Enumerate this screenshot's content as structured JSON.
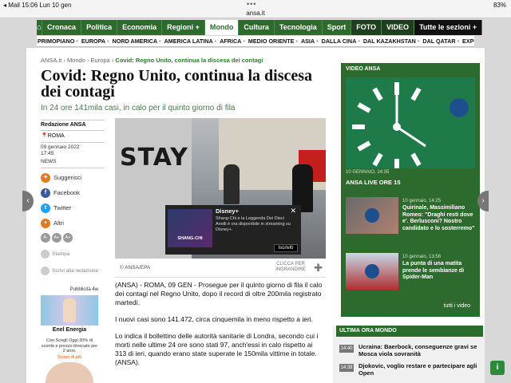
{
  "status": {
    "left": "◂ Mail   15:06   Lun 10 gen",
    "right": "83%"
  },
  "url": "ansa.it",
  "nav": {
    "items": [
      "Cronaca",
      "Politica",
      "Economia",
      "Regioni +",
      "Mondo",
      "Cultura",
      "Tecnologia",
      "Sport",
      "FOTO",
      "VIDEO",
      "Tutte le sezioni +"
    ]
  },
  "subnav": {
    "items": [
      "PRIMOPIANO",
      "EUROPA",
      "NORD AMERICA",
      "AMERICA LATINA",
      "AFRICA",
      "MEDIO ORIENTE",
      "ASIA",
      "DALLA CINA",
      "DAL KAZAKHSTAN",
      "DAL QATAR",
      "EXPO DUBAI"
    ]
  },
  "breadcrumb": {
    "home": "ANSA.it",
    "mondo": "Mondo",
    "europa": "Europa",
    "current": "Covid: Regno Unito, continua la discesa dei contagi"
  },
  "article": {
    "title": "Covid: Regno Unito, continua la discesa dei contagi",
    "subtitle": "In 24 ore 141mila casi, in calo per il quinto giorno di fila",
    "byline": "Redazione ANSA",
    "place": "ROMA",
    "date": "09 gennaio 2022",
    "time": "17:45",
    "type": "NEWS",
    "photo_credit": "© ANSA/EPA",
    "photo_text": "STAY SAFE",
    "click_enlarge": "CLICCA PER INGRANDIRE",
    "paragraphs": [
      "(ANSA) - ROMA, 09 GEN - Prosegue per il quinto giorno di fila il calo dei contagi nel Regno Unito, dopo il record di oltre 200mila registrato martedì.",
      "I nuovi casi sono 141.472, circa cinquemila in meno rispetto a ieri.",
      "Lo indica il bollettino delle autorità sanitarie di Londra, secondo cui i morti nelle ultime 24 ore sono stati 97, anch'essi in calo rispetto ai 313 di ieri, quando erano state superate le 150mila vittime in totale. (ANSA)."
    ]
  },
  "share": {
    "suggest": "Suggerisci",
    "facebook": "Facebook",
    "twitter": "Twitter",
    "altri": "Altri",
    "stampa": "Stampa",
    "scrivi": "Scrivi alla redazione"
  },
  "fontsize": [
    "A-",
    "A+",
    "A+"
  ],
  "ad": {
    "pub": "Pubblicità 4w",
    "brand": "Enel Energia",
    "text": "Con Scegli Oggi 30% di sconto e prezzo bloccato per 2 anni.",
    "cta": "Scopri di più"
  },
  "disney": {
    "brand": "Disney+",
    "close": "✕",
    "desc": "Shang-Chi e la Leggenda Dei Dieci Anelli è ora disponibile in streaming su Disney+.",
    "subscribe": "Iscriviti",
    "thumb_title": "SHANG-CHI"
  },
  "video": {
    "header": "VIDEO ANSA",
    "main_date": "10 GENNAIO, 14:35",
    "main_title": "ANSA LIVE ORE 15",
    "item2_date": "10 gennaio, 14:25",
    "item2_title": "Quirinale, Massimiliano Romeo: \"Draghi resti dove e'. Berlusconi? Nostro candidato e lo sosterremo\"",
    "item3_date": "10 gennaio, 13:56",
    "item3_title": "La punta di una matita prende le sembianze di Spider-Man",
    "all": "tutti i video"
  },
  "ultima": {
    "header": "ULTIMA ORA MONDO",
    "rows": [
      {
        "time": "14:40",
        "text": "Ucraina: Baerbock, conseguenze gravi se Mosca viola sovranità"
      },
      {
        "time": "14:38",
        "text": "Djokovic, voglio restare e partecipare agli Open"
      }
    ]
  },
  "colors": {
    "brand_green": "#2d6a2d",
    "accent_green": "#2d7a2d"
  }
}
